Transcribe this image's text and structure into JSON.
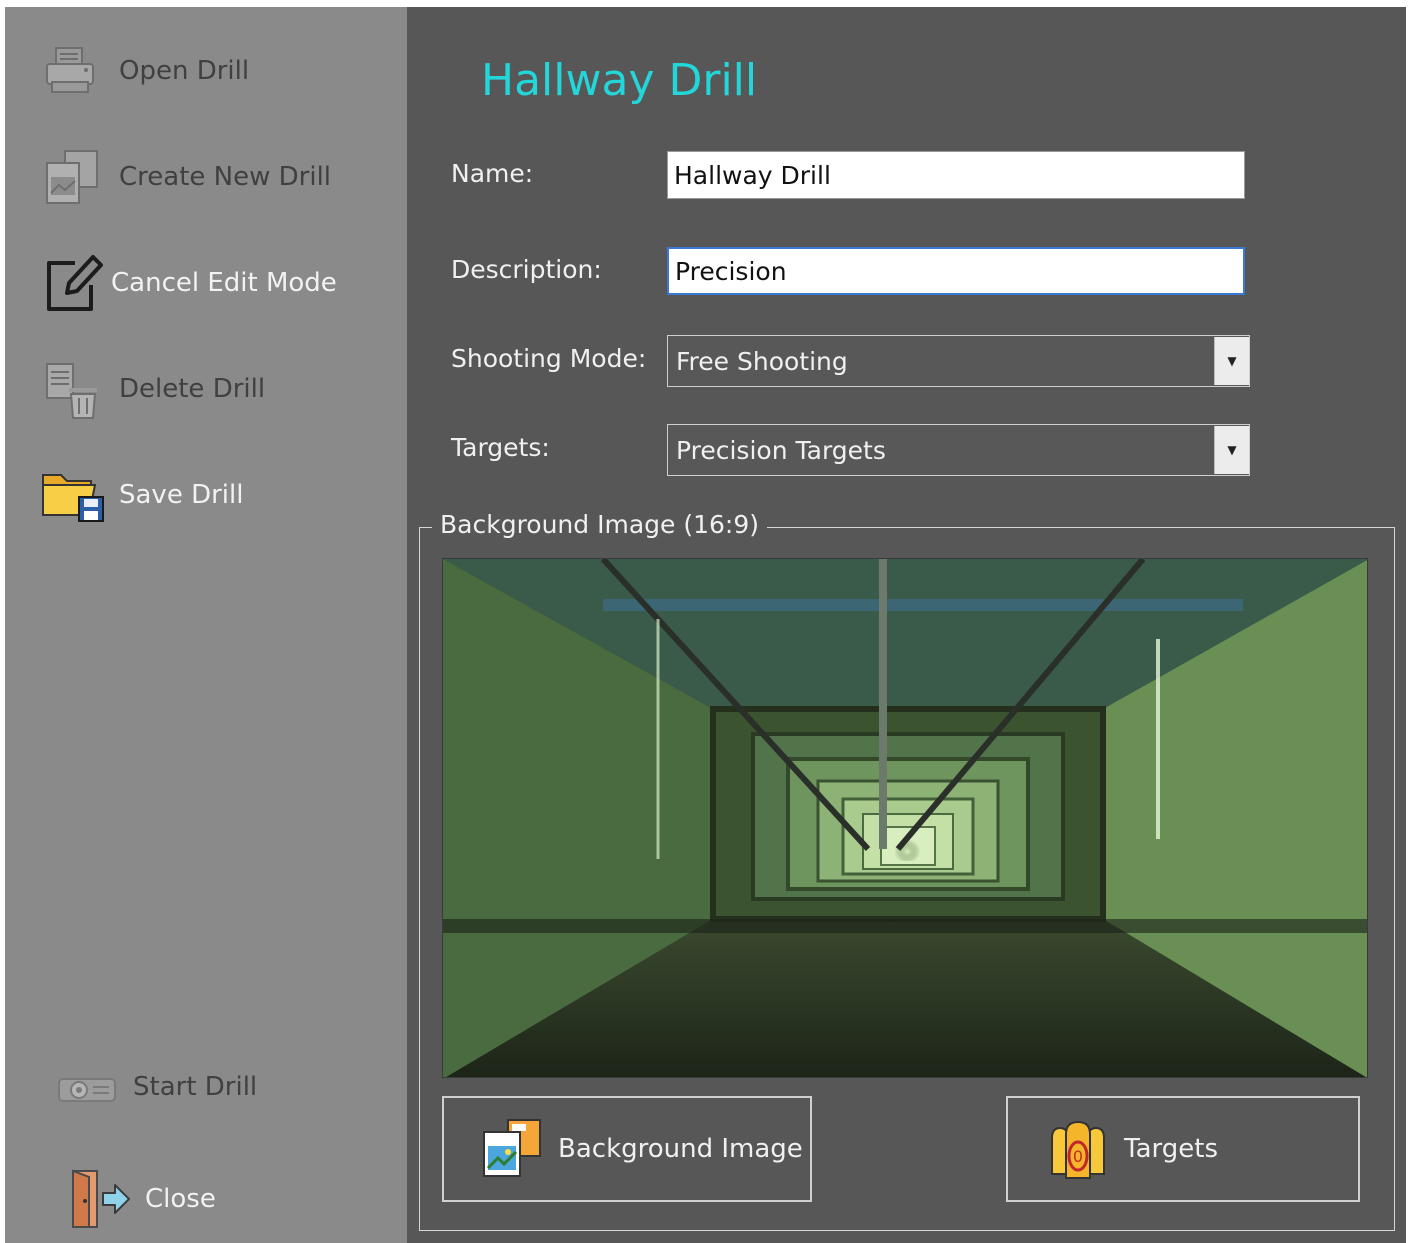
{
  "sidebar": {
    "items": [
      {
        "label": "Open Drill",
        "icon": "printer-icon",
        "active": false
      },
      {
        "label": "Create New Drill",
        "icon": "image-files-icon",
        "active": false
      },
      {
        "label": "Cancel Edit Mode",
        "icon": "edit-pencil-icon",
        "active": true
      },
      {
        "label": "Delete Drill",
        "icon": "delete-trash-icon",
        "active": false
      },
      {
        "label": "Save Drill",
        "icon": "folder-save-icon",
        "active": true
      }
    ],
    "bottom_items": [
      {
        "label": "Start Drill",
        "icon": "projector-icon",
        "active": false
      },
      {
        "label": "Close",
        "icon": "exit-door-icon",
        "active": true
      }
    ]
  },
  "main": {
    "title": "Hallway Drill",
    "name_label": "Name:",
    "name_value": "Hallway Drill",
    "description_label": "Description:",
    "description_value": "Precision",
    "shooting_mode_label": "Shooting Mode:",
    "shooting_mode_value": "Free Shooting",
    "targets_label": "Targets:",
    "targets_value": "Precision Targets",
    "group_label": "Background Image (16:9)",
    "background_button_label": "Background Image",
    "targets_button_label": "Targets"
  },
  "colors": {
    "sidebar_bg": "#8a8a8a",
    "main_bg": "#575757",
    "title_accent": "#22d6da",
    "active_text": "#f2f2f2",
    "inactive_text": "#404040"
  }
}
